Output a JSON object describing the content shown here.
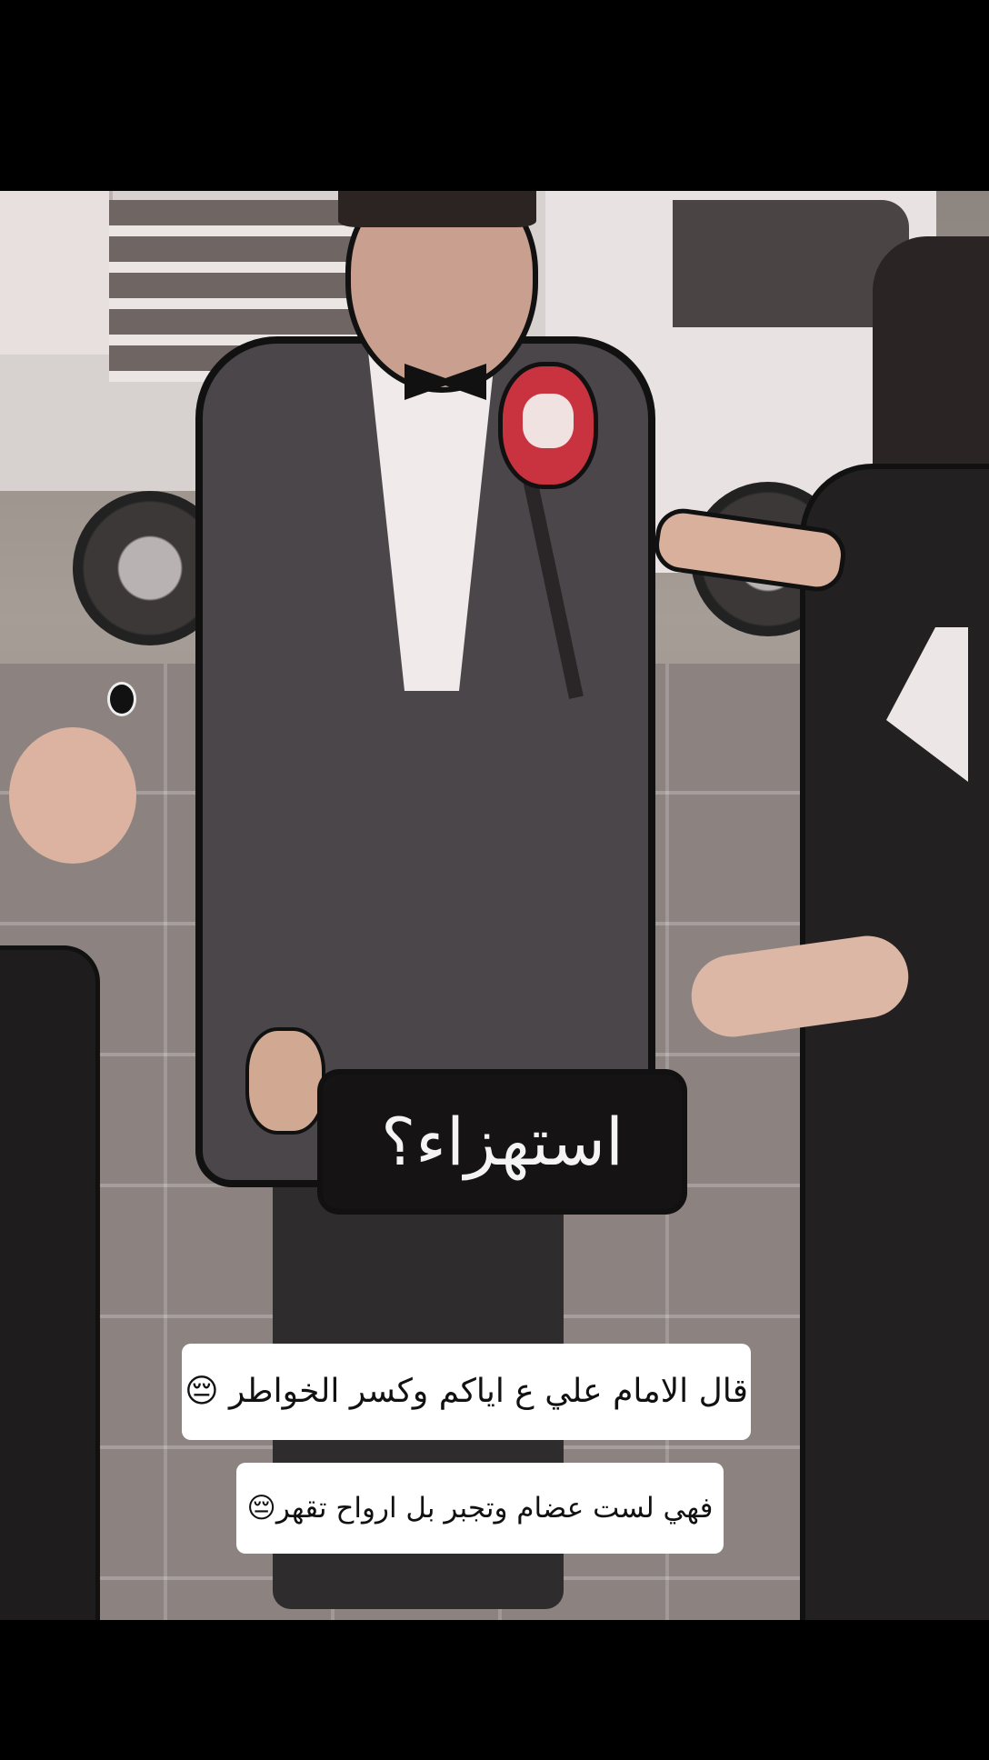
{
  "video": {
    "embedded_caption": "استهزاء؟"
  },
  "captions": {
    "line1": "قال الامام علي ع اياكم وكسر الخواطر 😔",
    "line2": "فهي لست عضام وتجبر بل ارواح تقهر😔"
  }
}
